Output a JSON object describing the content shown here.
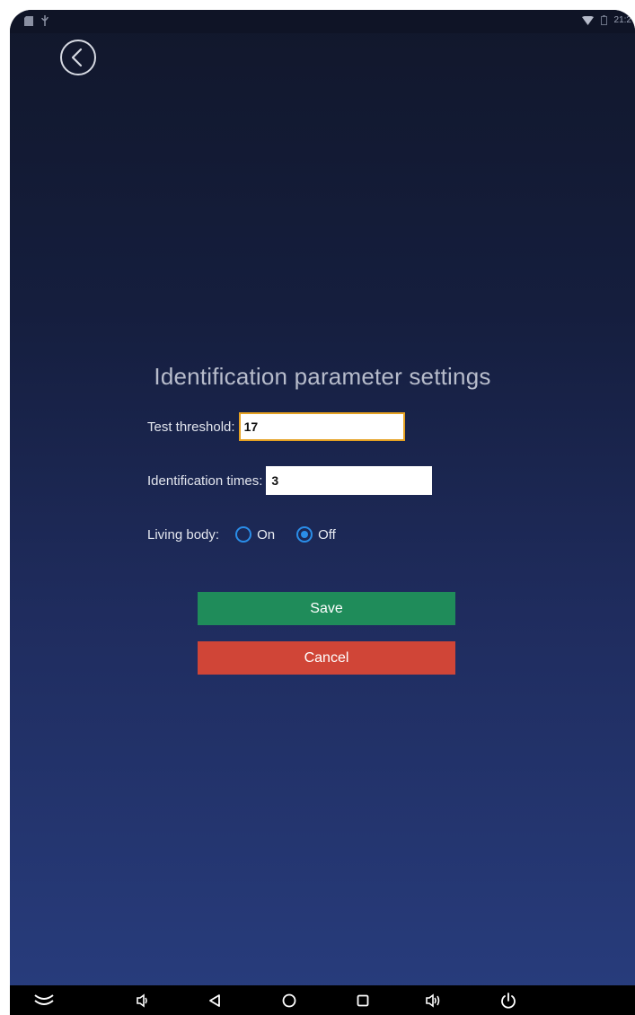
{
  "status_bar": {
    "time": "21:2",
    "left_icons": [
      "sd-card-icon",
      "usb-icon"
    ],
    "right_icons": [
      "wifi-icon",
      "battery-icon"
    ]
  },
  "back_button": {
    "icon": "back-chevron-icon"
  },
  "title": "Identification parameter settings",
  "fields": {
    "test_threshold": {
      "label": "Test threshold:",
      "value": "17"
    },
    "identification_times": {
      "label": "Identification times:",
      "value": "3"
    }
  },
  "living_body": {
    "label": "Living body:",
    "options": [
      {
        "label": "On",
        "selected": false
      },
      {
        "label": "Off",
        "selected": true
      }
    ]
  },
  "buttons": {
    "save": "Save",
    "cancel": "Cancel"
  },
  "colors": {
    "save": "#1f8c5a",
    "cancel": "#d04537",
    "radio_accent": "#2a8de8",
    "focus_border": "#e5a122"
  },
  "nav_bar": {
    "icons": [
      "hide-bar-icon",
      "volume-down-icon",
      "back-icon",
      "home-icon",
      "recents-icon",
      "volume-up-icon",
      "power-icon"
    ]
  }
}
